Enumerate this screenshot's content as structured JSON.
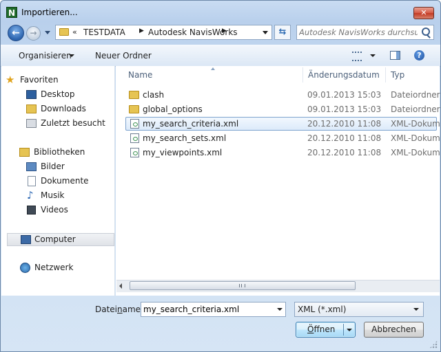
{
  "window": {
    "title": "Importieren...",
    "app_icon_letter": "N",
    "close_glyph": "✕"
  },
  "navigation": {
    "back_glyph": "←",
    "forward_glyph": "→",
    "address": {
      "overflow": "«",
      "segments": [
        "TESTDATA",
        "Autodesk NavisWorks"
      ],
      "separator": "▶"
    },
    "refresh_glyph": "⇆",
    "search_placeholder": "Autodesk NavisWorks durchsu..."
  },
  "toolbar": {
    "organize_label": "Organisieren",
    "new_folder_label": "Neuer Ordner",
    "help_glyph": "?"
  },
  "sidebar": {
    "favorites": {
      "label": "Favoriten",
      "items": [
        {
          "label": "Desktop",
          "icon": "desktop-icon"
        },
        {
          "label": "Downloads",
          "icon": "downloads-icon"
        },
        {
          "label": "Zuletzt besucht",
          "icon": "recent-places-icon"
        }
      ]
    },
    "libraries": {
      "label": "Bibliotheken",
      "items": [
        {
          "label": "Bilder",
          "icon": "pictures-icon"
        },
        {
          "label": "Dokumente",
          "icon": "documents-icon"
        },
        {
          "label": "Musik",
          "icon": "music-icon"
        },
        {
          "label": "Videos",
          "icon": "videos-icon"
        }
      ]
    },
    "computer": {
      "label": "Computer"
    },
    "network": {
      "label": "Netzwerk"
    }
  },
  "file_list": {
    "columns": [
      "Name",
      "Änderungsdatum",
      "Typ"
    ],
    "rows": [
      {
        "name": "clash",
        "date": "09.01.2013 15:03",
        "type": "Dateiordner",
        "icon": "folder-icon",
        "selected": false
      },
      {
        "name": "global_options",
        "date": "09.01.2013 15:03",
        "type": "Dateiordner",
        "icon": "folder-icon",
        "selected": false
      },
      {
        "name": "my_search_criteria.xml",
        "date": "20.12.2010 11:08",
        "type": "XML-Dokum",
        "icon": "xml-file-icon",
        "selected": true
      },
      {
        "name": "my_search_sets.xml",
        "date": "20.12.2010 11:08",
        "type": "XML-Dokum",
        "icon": "xml-file-icon",
        "selected": false
      },
      {
        "name": "my_viewpoints.xml",
        "date": "20.12.2010 11:08",
        "type": "XML-Dokum",
        "icon": "xml-file-icon",
        "selected": false
      }
    ]
  },
  "bottom": {
    "filename_label_prefix": "Datei",
    "filename_label_mnemonic": "n",
    "filename_label_suffix": "ame:",
    "filename_value": "my_search_criteria.xml",
    "file_type": "XML (*.xml)",
    "open_label_mnemonic": "Ö",
    "open_label_rest": "ffnen",
    "cancel_label": "Abbrechen"
  },
  "colors": {
    "selection_border": "#7da2ce",
    "title_bar": "#c9dcf2",
    "close_button": "#c23a24"
  }
}
